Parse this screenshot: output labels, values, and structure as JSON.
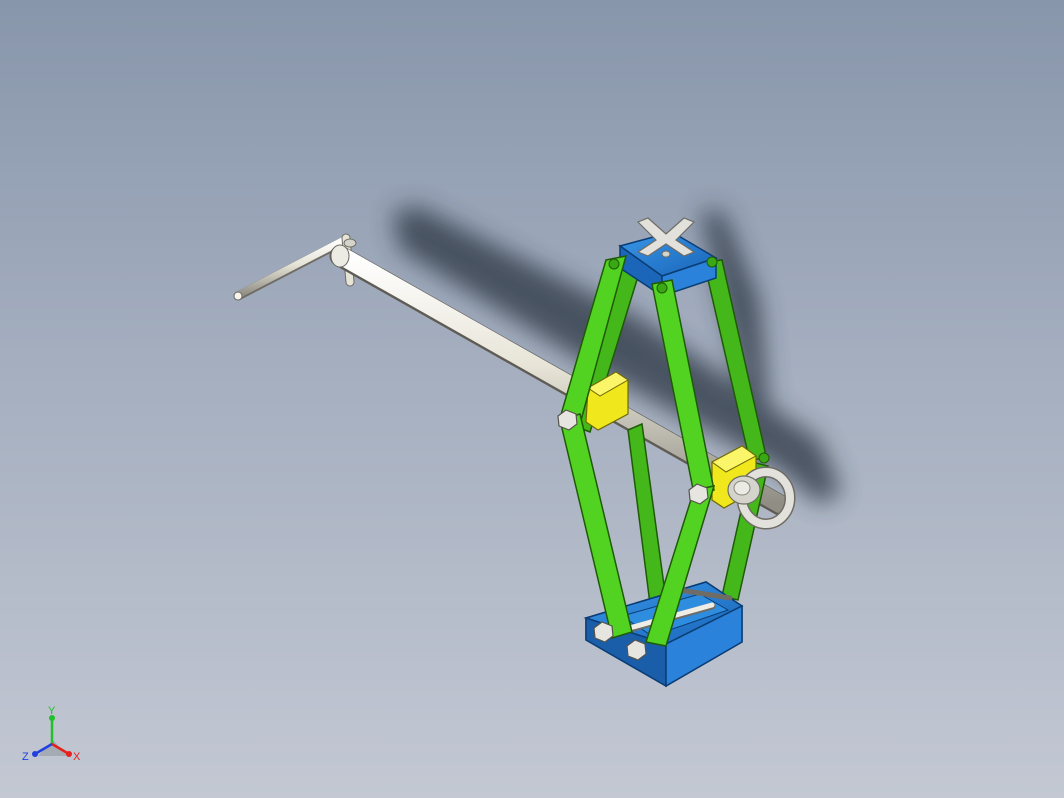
{
  "viewport": {
    "background_top": "#8896ab",
    "background_bottom": "#c3c8d3"
  },
  "model": {
    "colors": {
      "scissor_arm": "#52d321",
      "scissor_arm_edge": "#1f5a06",
      "base_block": "#1f78d2",
      "top_saddle": "#1f78d2",
      "nut_block": "#f0e81c",
      "screw_rod": "#e7e4d7",
      "hardware": "#d5d4cc"
    },
    "parts": [
      "crank-handle",
      "lead-screw",
      "scissor-arm",
      "top-saddle",
      "base-block",
      "trunnion-nut",
      "eye-bolt",
      "hex-bolt",
      "cross-pin"
    ]
  },
  "triad": {
    "x_label": "X",
    "y_label": "Y",
    "z_label": "Z",
    "x_color": "#e8201c",
    "y_color": "#22c02a",
    "z_color": "#2040e0"
  }
}
